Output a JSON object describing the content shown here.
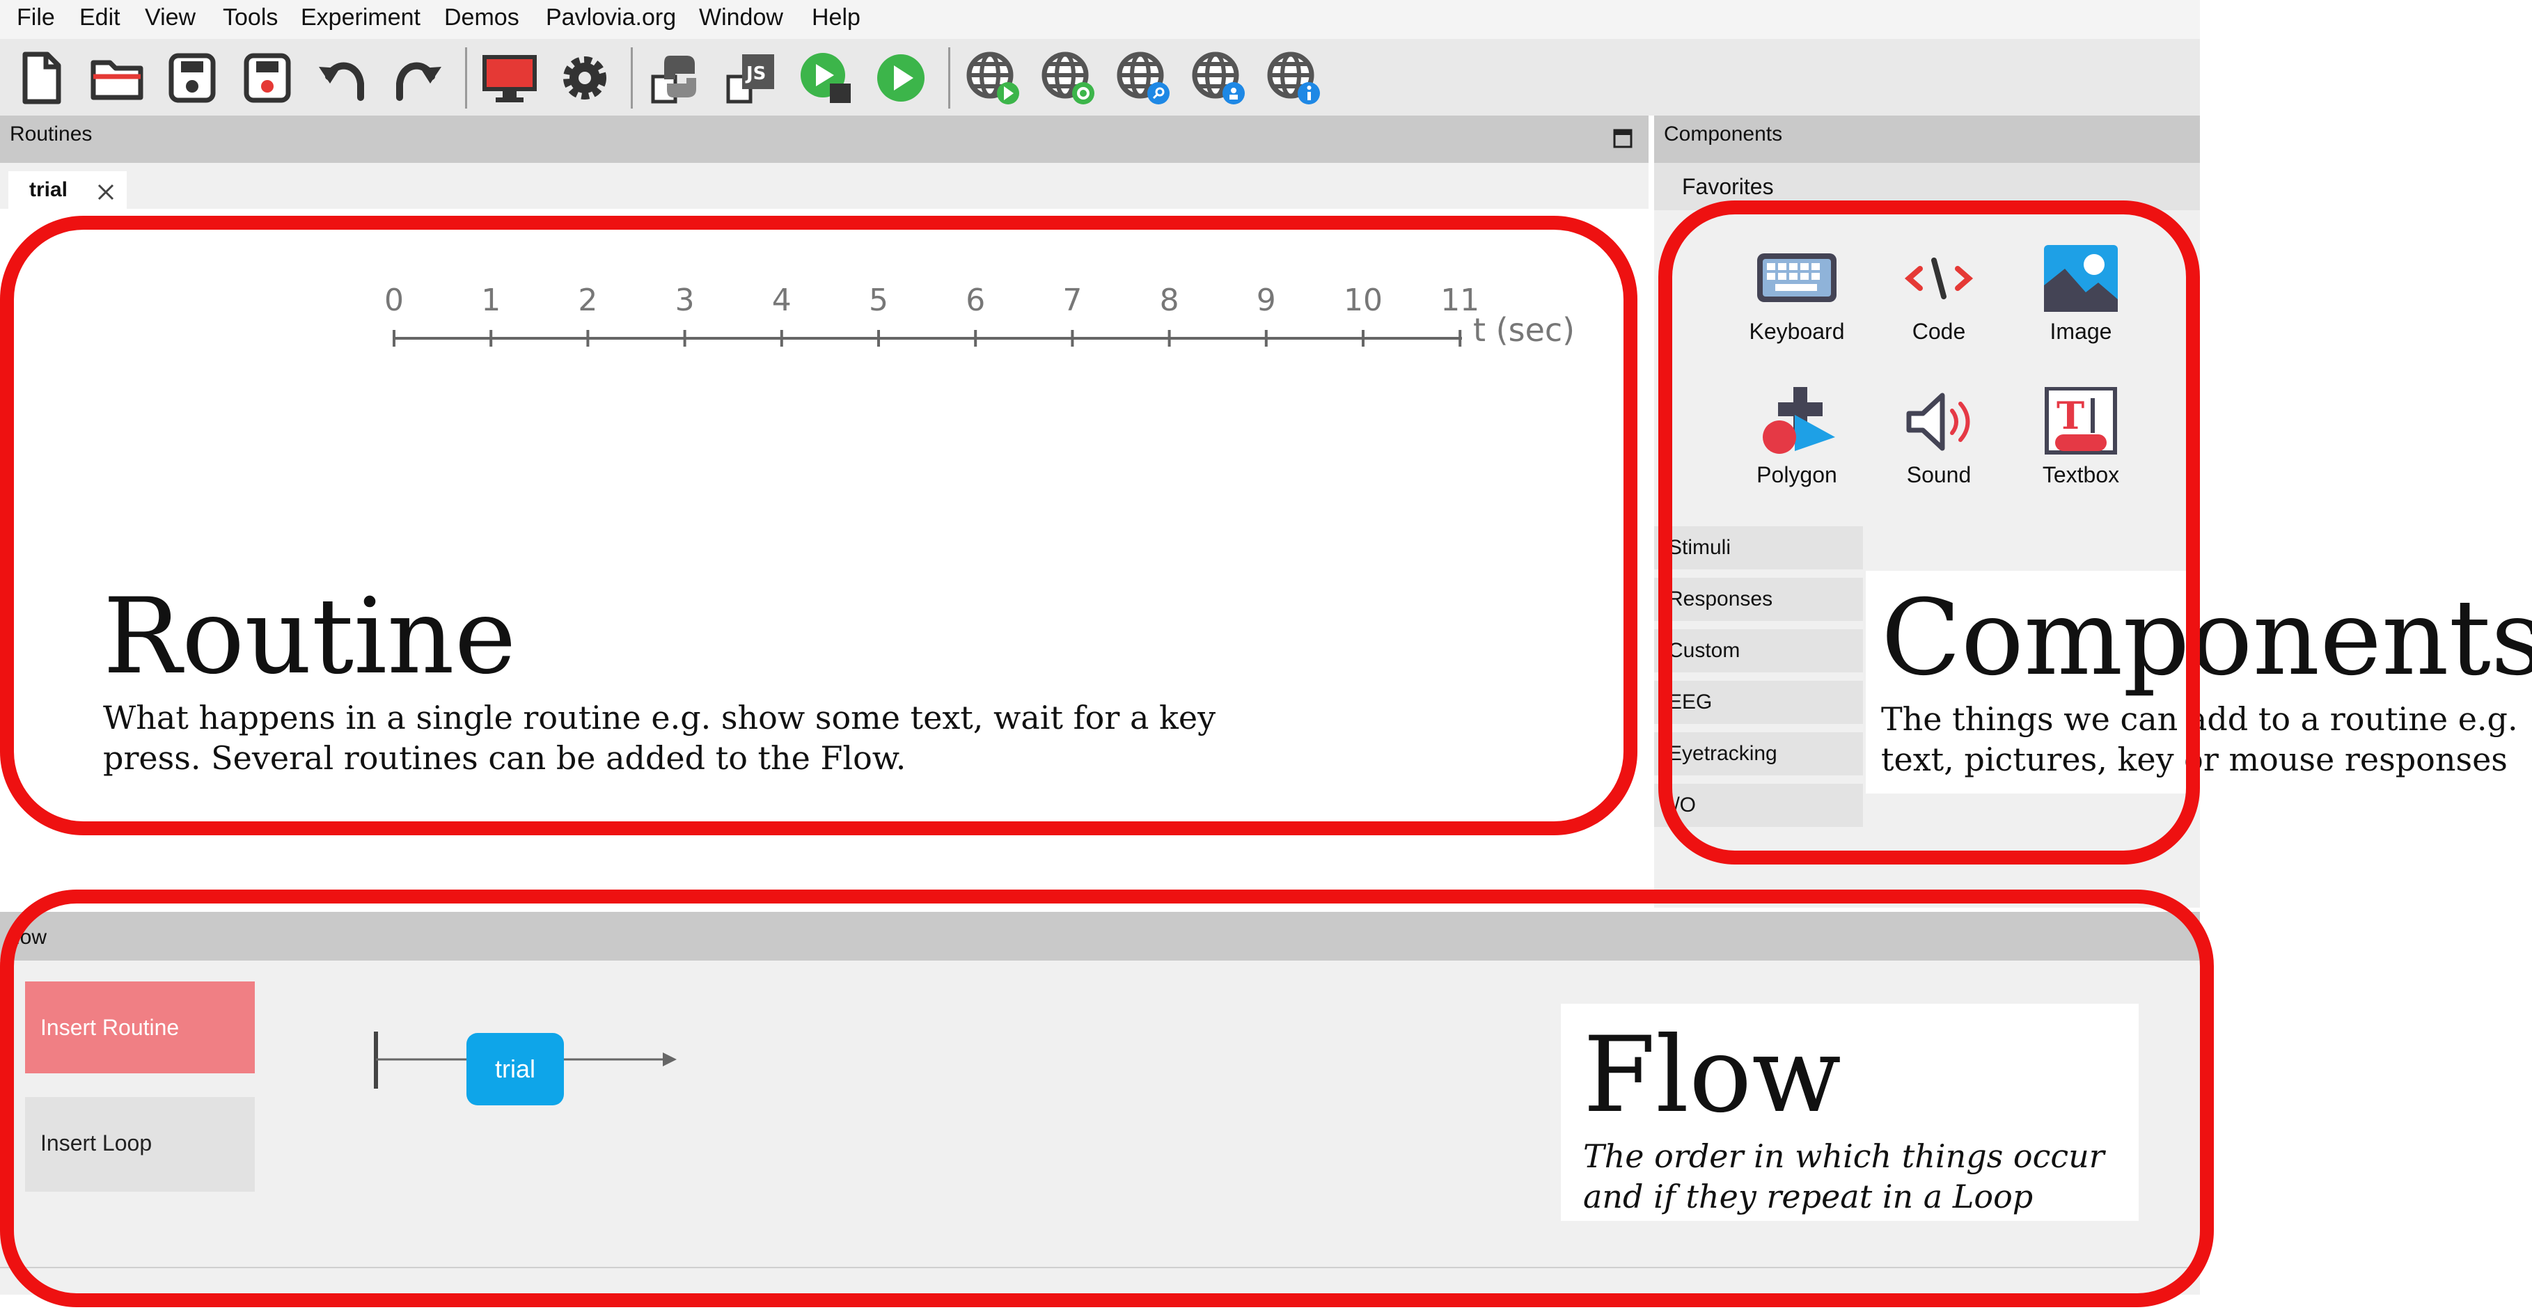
{
  "menu": [
    "File",
    "Edit",
    "View",
    "Tools",
    "Experiment",
    "Demos",
    "Pavlovia.org",
    "Window",
    "Help"
  ],
  "toolbar_icons": [
    "new-file-icon",
    "open-folder-icon",
    "save-icon",
    "save-as-icon",
    "undo-icon",
    "redo-icon",
    "monitor-icon",
    "gear-icon",
    "python-icon",
    "js-icon",
    "run-piloting-icon",
    "run-icon",
    "globe-run-icon",
    "globe-sync-icon",
    "globe-search-icon",
    "globe-user-icon",
    "globe-info-icon"
  ],
  "routines": {
    "title": "Routines",
    "tab": "trial",
    "timeline": {
      "ticks": [
        "0",
        "1",
        "2",
        "3",
        "4",
        "5",
        "6",
        "7",
        "8",
        "9",
        "10",
        "11"
      ],
      "unit": "t (sec)"
    }
  },
  "components": {
    "title": "Components",
    "favorites": "Favorites",
    "items": [
      {
        "label": "Keyboard",
        "icon": "keyboard-icon"
      },
      {
        "label": "Code",
        "icon": "code-icon"
      },
      {
        "label": "Image",
        "icon": "image-icon"
      },
      {
        "label": "Polygon",
        "icon": "polygon-icon"
      },
      {
        "label": "Sound",
        "icon": "speaker-icon"
      },
      {
        "label": "Textbox",
        "icon": "textbox-icon"
      }
    ],
    "categories": [
      "Stimuli",
      "Responses",
      "Custom",
      "EEG",
      "Eyetracking",
      "I/O"
    ]
  },
  "flow": {
    "title": "low",
    "insert_routine": "Insert Routine",
    "insert_loop": "Insert Loop",
    "routine_box": "trial"
  },
  "annotations": {
    "routine": {
      "title": "Routine",
      "line1": "What happens in a single routine e.g. show some text, wait for a key",
      "line2": "press. Several routines can be added to the Flow."
    },
    "components": {
      "title": "Components",
      "line1": "The things we can add to a routine e.g.",
      "line2": "text, pictures, key or mouse responses"
    },
    "flow": {
      "title": "Flow",
      "line1": "The order in which things occur",
      "line2": "and if they repeat in a Loop"
    }
  },
  "colors": {
    "highlight_red": "#ee1111",
    "run_green": "#3cb54a",
    "flow_routine_blue": "#0ea5e9",
    "insert_routine_pink": "#f07f84"
  }
}
